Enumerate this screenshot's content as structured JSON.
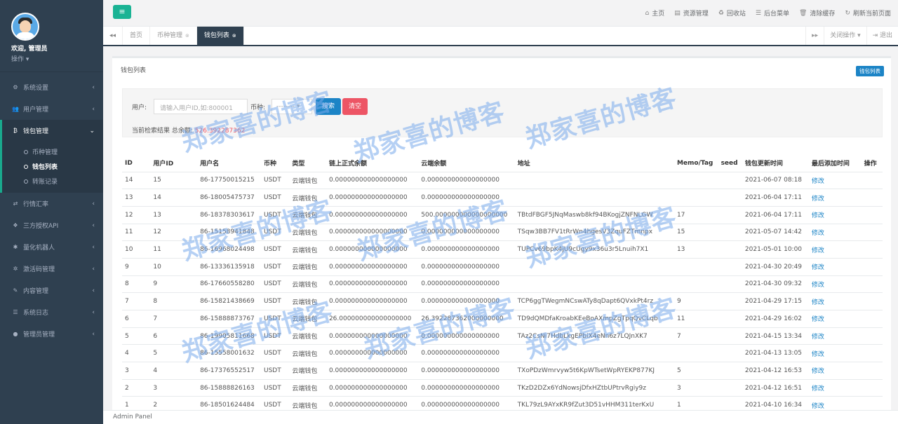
{
  "sidebar": {
    "welcome": "欢迎, 管理员",
    "op_label": "操作 ▾",
    "items": [
      {
        "icon": "gear-icon",
        "glyph": "⚙",
        "label": "系统设置"
      },
      {
        "icon": "users-icon",
        "glyph": "👥",
        "label": "用户管理"
      }
    ],
    "wallet_menu": {
      "icon": "bitcoin-icon",
      "glyph": "₿",
      "label": "钱包管理",
      "sub": [
        {
          "label": "币种管理"
        },
        {
          "label": "钱包列表"
        },
        {
          "label": "转账记录"
        }
      ]
    },
    "items_after": [
      {
        "icon": "exchange-icon",
        "glyph": "⇄",
        "label": "行情汇率"
      },
      {
        "icon": "cubes-icon",
        "glyph": "❖",
        "label": "三方授权API"
      },
      {
        "icon": "robot-icon",
        "glyph": "✱",
        "label": "量化机器人"
      },
      {
        "icon": "cog-icon",
        "glyph": "✲",
        "label": "激活码管理"
      },
      {
        "icon": "edit-icon",
        "glyph": "✎",
        "label": "内容管理"
      },
      {
        "icon": "database-icon",
        "glyph": "☰",
        "label": "系统日志"
      },
      {
        "icon": "user-circle-icon",
        "glyph": "●",
        "label": "管理员管理"
      }
    ]
  },
  "topbar": {
    "links": [
      {
        "icon": "home-icon",
        "glyph": "⌂",
        "label": "主页"
      },
      {
        "icon": "file-icon",
        "glyph": "▤",
        "label": "资源管理"
      },
      {
        "icon": "recycle-icon",
        "glyph": "♻",
        "label": "回收站"
      },
      {
        "icon": "list-icon",
        "glyph": "☰",
        "label": "后台菜单"
      },
      {
        "icon": "trash-icon",
        "glyph": "🗑",
        "label": "清除缓存"
      },
      {
        "icon": "refresh-icon",
        "glyph": "↻",
        "label": "刷新当前页面"
      }
    ]
  },
  "tabs": {
    "items": [
      {
        "label": "首页",
        "closable": false
      },
      {
        "label": "币种管理",
        "closable": true
      },
      {
        "label": "钱包列表",
        "closable": true,
        "active": true
      }
    ],
    "close_ops": "关闭操作 ▾",
    "logout": "⇥ 退出"
  },
  "panel": {
    "title": "钱包列表",
    "badge": "钱包列表",
    "filter": {
      "user_label": "用户:",
      "user_placeholder": "请输入用户ID,如:800001",
      "coin_label": "币种:",
      "coin_value": "-------- ▾",
      "search_label": "搜索",
      "clear_label": "清空",
      "result_prefix": "当前检索结果 总余额:",
      "result_amount": "526.392287362"
    }
  },
  "table": {
    "headers": [
      "ID",
      "用户ID",
      "用户名",
      "币种",
      "类型",
      "链上正式余额",
      "云端余额",
      "地址",
      "Memo/Tag",
      "seed",
      "钱包更新时间",
      "最后添加时间",
      "操作"
    ],
    "rows": [
      [
        "14",
        "15",
        "86-17750015215",
        "USDT",
        "云端钱包",
        "0.000000000000000000",
        "0.000000000000000000",
        "",
        "",
        "",
        "2021-06-07 08:18",
        "修改"
      ],
      [
        "13",
        "14",
        "86-18005475737",
        "USDT",
        "云端钱包",
        "0.000000000000000000",
        "0.000000000000000000",
        "",
        "",
        "",
        "2021-06-04 17:11",
        "修改"
      ],
      [
        "12",
        "13",
        "86-18378303617",
        "USDT",
        "云端钱包",
        "0.000000000000000000",
        "500.000000000000000000",
        "TBtdFBGF5JNqMaswb8kf94BKogjZNFNLGW",
        "17",
        "",
        "2021-06-04 17:11",
        "修改"
      ],
      [
        "11",
        "12",
        "86-15158941848",
        "USDT",
        "云端钱包",
        "0.000000000000000000",
        "0.000000000000000000",
        "TSqw3BB7FV1tRrWn4hgesV3ZquFZTmnpx",
        "15",
        "",
        "2021-05-07 14:42",
        "修改"
      ],
      [
        "10",
        "11",
        "86-16968024498",
        "USDT",
        "云端钱包",
        "0.000000000000000000",
        "0.000000000000000000",
        "TUPCv69bpK4jU9cUgy9x36u3r5Lnuih7X1",
        "13",
        "",
        "2021-05-01 10:00",
        "修改"
      ],
      [
        "9",
        "10",
        "86-13336135918",
        "USDT",
        "云端钱包",
        "0.000000000000000000",
        "0.000000000000000000",
        "",
        "",
        "",
        "2021-04-30 20:49",
        "修改"
      ],
      [
        "8",
        "9",
        "86-17660558280",
        "USDT",
        "云端钱包",
        "0.000000000000000000",
        "0.000000000000000000",
        "",
        "",
        "",
        "2021-04-30 09:32",
        "修改"
      ],
      [
        "7",
        "8",
        "86-15821438669",
        "USDT",
        "云端钱包",
        "0.000000000000000000",
        "0.000000000000000000",
        "TCP6ggTWegmNCswATy8qDapt6QVxkPt4rz",
        "9",
        "",
        "2021-04-29 17:15",
        "修改"
      ],
      [
        "6",
        "7",
        "86-15888873767",
        "USDT",
        "云端钱包",
        "26.000000000000000000",
        "26.392287362000000000",
        "TD9dQMDfaKroabKEeBoAXmpZgTpqQvCLqb",
        "11",
        "",
        "2021-04-29 16:02",
        "修改"
      ],
      [
        "5",
        "6",
        "86-19905811668",
        "USDT",
        "云端钱包",
        "0.000000000000000000",
        "0.000000000000000000",
        "TAz2CsNi7HdbLkgEPbiX4eNn6z7LQJnXK7",
        "7",
        "",
        "2021-04-15 13:34",
        "修改"
      ],
      [
        "4",
        "5",
        "86-15558001632",
        "USDT",
        "云端钱包",
        "0.000000000000000000",
        "0.000000000000000000",
        "",
        "",
        "",
        "2021-04-13 13:05",
        "修改"
      ],
      [
        "3",
        "4",
        "86-17376552517",
        "USDT",
        "云端钱包",
        "0.000000000000000000",
        "0.000000000000000000",
        "TXoPDzWmrvyw5t6KpWTsetWpRYEKP877KJ",
        "5",
        "",
        "2021-04-12 16:53",
        "修改"
      ],
      [
        "2",
        "3",
        "86-15888826163",
        "USDT",
        "云端钱包",
        "0.000000000000000000",
        "0.000000000000000000",
        "TKzD2DZx6YdNowsjDfxHZtbUPtrvRgiy9z",
        "3",
        "",
        "2021-04-12 16:51",
        "修改"
      ],
      [
        "1",
        "2",
        "86-18501624484",
        "USDT",
        "云端钱包",
        "0.000000000000000000",
        "0.000000000000000000",
        "TKL79zL9AYxKR9fZut3D51vHHM311terKxU",
        "1",
        "",
        "2021-04-10 16:34",
        "修改"
      ]
    ]
  },
  "footer": {
    "text": "Admin Panel"
  },
  "watermark": {
    "text": "郑家喜的博客"
  }
}
